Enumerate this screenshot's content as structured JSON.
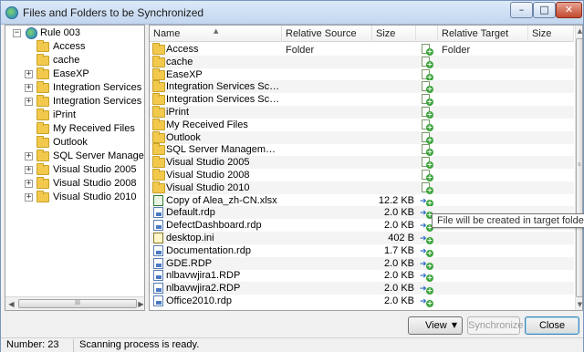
{
  "window": {
    "title": "Files and Folders to be Synchronized",
    "buttons": {
      "minimize": "–",
      "maximize": "□",
      "close": "✕"
    }
  },
  "tree": {
    "root": "Rule 003",
    "items": [
      {
        "label": "Access",
        "expandable": false
      },
      {
        "label": "cache",
        "expandable": false
      },
      {
        "label": "EaseXP",
        "expandable": true
      },
      {
        "label": "Integration Services Script",
        "expandable": true
      },
      {
        "label": "Integration Services Script",
        "expandable": true
      },
      {
        "label": "iPrint",
        "expandable": false
      },
      {
        "label": "My Received Files",
        "expandable": false
      },
      {
        "label": "Outlook",
        "expandable": false
      },
      {
        "label": "SQL Server Management S",
        "expandable": true
      },
      {
        "label": "Visual Studio 2005",
        "expandable": true
      },
      {
        "label": "Visual Studio 2008",
        "expandable": true
      },
      {
        "label": "Visual Studio 2010",
        "expandable": true
      }
    ],
    "expand_symbol": "+",
    "collapse_symbol": "−",
    "scroll_left": "◀",
    "scroll_right": "▶",
    "scroll_grip": "III"
  },
  "list": {
    "sort_arrow": "▲",
    "columns": [
      "Name",
      "Relative Source Folder",
      "Size",
      "Relative Target Folder",
      "Size"
    ],
    "rows": [
      {
        "name": "Access",
        "type": "folder",
        "size": ""
      },
      {
        "name": "cache",
        "type": "folder",
        "size": ""
      },
      {
        "name": "EaseXP",
        "type": "folder",
        "size": ""
      },
      {
        "name": "Integration Services Script C...",
        "type": "folder",
        "size": ""
      },
      {
        "name": "Integration Services Script Task",
        "type": "folder",
        "size": ""
      },
      {
        "name": "iPrint",
        "type": "folder",
        "size": ""
      },
      {
        "name": "My Received Files",
        "type": "folder",
        "size": ""
      },
      {
        "name": "Outlook",
        "type": "folder",
        "size": ""
      },
      {
        "name": "SQL Server Management Studio",
        "type": "folder",
        "size": ""
      },
      {
        "name": "Visual Studio 2005",
        "type": "folder",
        "size": ""
      },
      {
        "name": "Visual Studio 2008",
        "type": "folder",
        "size": ""
      },
      {
        "name": "Visual Studio 2010",
        "type": "folder",
        "size": ""
      },
      {
        "name": "Copy of Alea_zh-CN.xlsx",
        "type": "xlsx",
        "size": "12.2 KB"
      },
      {
        "name": "Default.rdp",
        "type": "rdp",
        "size": "2.0 KB"
      },
      {
        "name": "DefectDashboard.rdp",
        "type": "rdp",
        "size": "2.0 KB"
      },
      {
        "name": "desktop.ini",
        "type": "ini",
        "size": "402 B"
      },
      {
        "name": "Documentation.rdp",
        "type": "rdp",
        "size": "1.7 KB"
      },
      {
        "name": "GDE.RDP",
        "type": "rdp",
        "size": "2.0 KB"
      },
      {
        "name": "nlbavwjira1.RDP",
        "type": "rdp",
        "size": "2.0 KB"
      },
      {
        "name": "nlbavwjira2.RDP",
        "type": "rdp",
        "size": "2.0 KB"
      },
      {
        "name": "Office2010.rdp",
        "type": "rdp",
        "size": "2.0 KB"
      }
    ],
    "action_plus": "+",
    "action_arrow": "➜",
    "tooltip": "File will be created in target folder.",
    "scroll_up": "▲",
    "scroll_down": "▼",
    "scroll_grip": "≡"
  },
  "buttons": {
    "view": "View",
    "view_caret": "▼",
    "synchronize": "Synchronize",
    "close": "Close"
  },
  "status": {
    "number": "Number: 23",
    "message": "Scanning process is ready."
  },
  "colors": {
    "accent": "#3c7fb1",
    "folder": "#f2c94c",
    "create_action": "#3aa33a"
  }
}
